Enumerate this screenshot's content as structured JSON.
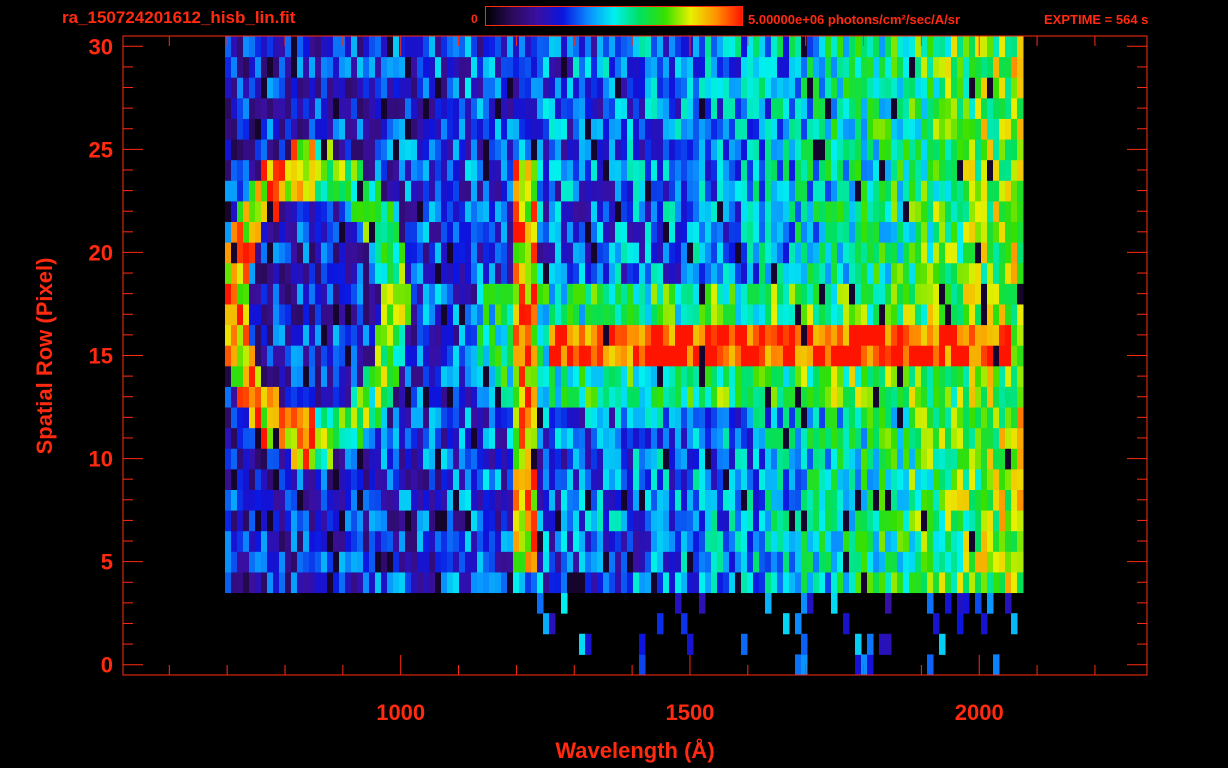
{
  "header": {
    "file_title": "ra_150724201612_hisb_lin.fit",
    "colorbar_min": "0",
    "colorbar_max_label": "5.00000e+06 photons/cm²/sec/A/sr",
    "exptime_label": "EXPTIME = 564 s"
  },
  "colors": {
    "axis": "#ff2a10",
    "background": "#000000",
    "colormap": [
      "#000000",
      "#2a0a5a",
      "#3a0fa0",
      "#0b14e0",
      "#0a8cff",
      "#00f0f0",
      "#00e060",
      "#37e000",
      "#e8f000",
      "#ff9000",
      "#ff1400"
    ]
  },
  "chart_data": {
    "type": "heatmap",
    "title": "ra_150724201612_hisb_lin.fit",
    "xlabel": "Wavelength (Å)",
    "ylabel": "Spatial Row (Pixel)",
    "xlim": [
      520,
      2290
    ],
    "ylim": [
      -0.5,
      30.5
    ],
    "xticks": [
      1000,
      1500,
      2000
    ],
    "yticks": [
      0,
      5,
      10,
      15,
      20,
      25,
      30
    ],
    "colorbar": {
      "min": 0,
      "max": 5000000,
      "units": "photons/cm²/sec/A/sr"
    },
    "grid": false,
    "features": [
      {
        "name": "detector_band",
        "x_range": [
          700,
          2080
        ],
        "y_range": [
          4,
          30
        ],
        "intensity": 0.25
      },
      {
        "name": "long_wavelength_band",
        "x_range": [
          1600,
          2080
        ],
        "y_range": [
          4,
          30
        ],
        "intensity": 0.5
      },
      {
        "name": "ring",
        "center": [
          850,
          17.5
        ],
        "radii": [
          140,
          6.5
        ],
        "intensity": 0.65
      },
      {
        "name": "lyman_alpha_line",
        "x": 1216,
        "y_range": [
          5,
          24
        ],
        "intensity": 0.85
      },
      {
        "name": "spectrum_trace",
        "x_range": [
          1260,
          2060
        ],
        "y_range": [
          14.5,
          16
        ],
        "intensity": 1.0
      },
      {
        "name": "trace_halo",
        "x_range": [
          1130,
          2060
        ],
        "y_range": [
          12.5,
          18
        ],
        "intensity": 0.55
      }
    ]
  }
}
